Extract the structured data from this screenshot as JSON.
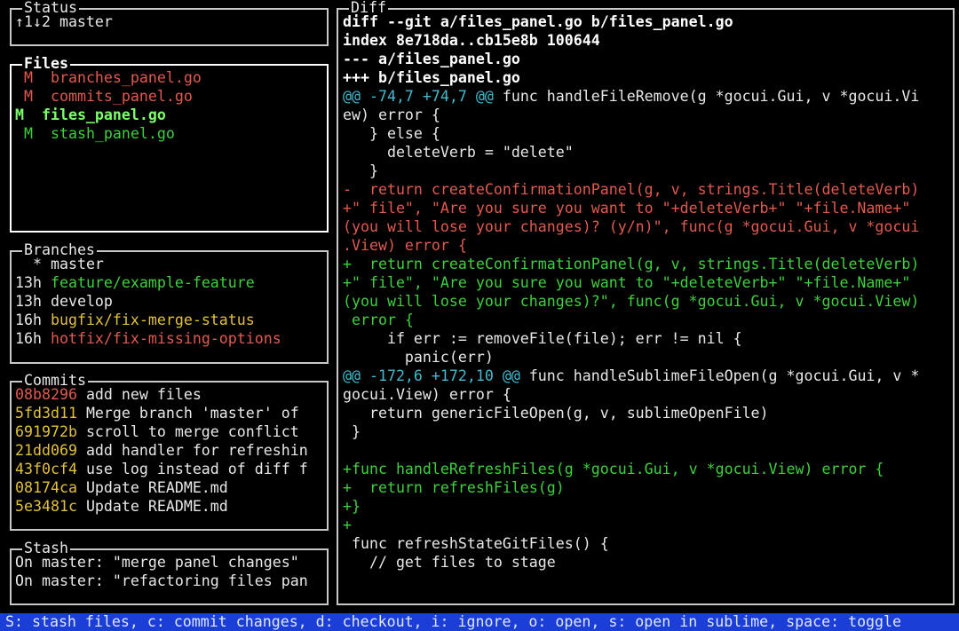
{
  "status": {
    "title": "Status",
    "text": "↑1↓2 master"
  },
  "files": {
    "title": "Files",
    "items": [
      {
        "status": "M",
        "name": "branches_panel.go",
        "color": "#e05a4f",
        "selected": false
      },
      {
        "status": "M",
        "name": "commits_panel.go",
        "color": "#e05a4f",
        "selected": false
      },
      {
        "status": "M",
        "name": "files_panel.go",
        "color": "#7cff6a",
        "selected": true
      },
      {
        "status": "M",
        "name": "stash_panel.go",
        "color": "#3fd03f",
        "selected": false
      }
    ]
  },
  "branches": {
    "title": "Branches",
    "items": [
      {
        "age": "  *",
        "name": "master",
        "color": "#e8e8e8"
      },
      {
        "age": "13h",
        "name": "feature/example-feature",
        "color": "#3fd03f"
      },
      {
        "age": "13h",
        "name": "develop",
        "color": "#e8e8e8"
      },
      {
        "age": "16h",
        "name": "bugfix/fix-merge-status",
        "color": "#e2c13a"
      },
      {
        "age": "16h",
        "name": "hotfix/fix-missing-options",
        "color": "#e05a4f"
      }
    ]
  },
  "commits": {
    "title": "Commits",
    "items": [
      {
        "sha": "08b8296",
        "message": "add new files",
        "sha_color": "#e05a4f"
      },
      {
        "sha": "5fd3d11",
        "message": "Merge branch 'master' of",
        "sha_color": "#e2c13a"
      },
      {
        "sha": "691972b",
        "message": "scroll to merge conflict",
        "sha_color": "#e2c13a"
      },
      {
        "sha": "21dd069",
        "message": "add handler for refreshin",
        "sha_color": "#e2c13a"
      },
      {
        "sha": "43f0cf4",
        "message": "use log instead of diff f",
        "sha_color": "#e2c13a"
      },
      {
        "sha": "08174ca",
        "message": "Update README.md",
        "sha_color": "#e2c13a"
      },
      {
        "sha": "5e3481c",
        "message": "Update README.md",
        "sha_color": "#e2c13a"
      }
    ]
  },
  "stash": {
    "title": "Stash",
    "items": [
      "On master: \"merge panel changes\"",
      "On master: \"refactoring files pan"
    ]
  },
  "diff": {
    "title": "Diff",
    "lines": [
      {
        "text": "diff --git a/files_panel.go b/files_panel.go",
        "style": "boldwhite"
      },
      {
        "text": "index 8e718da..cb15e8b 100644",
        "style": "boldwhite"
      },
      {
        "text": "--- a/files_panel.go",
        "style": "boldwhite"
      },
      {
        "text": "+++ b/files_panel.go",
        "style": "boldwhite"
      },
      {
        "text": "@@ -74,7 +74,7 @@",
        "rest": " func handleFileRemove(g *gocui.Gui, v *gocui.Vi",
        "style": "hunk"
      },
      {
        "text": "ew) error {",
        "style": "default"
      },
      {
        "text": "   } else {",
        "style": "default"
      },
      {
        "text": "     deleteVerb = \"delete\"",
        "style": "default"
      },
      {
        "text": "   }",
        "style": "default"
      },
      {
        "text": "-  return createConfirmationPanel(g, v, strings.Title(deleteVerb)",
        "style": "red"
      },
      {
        "text": "+\" file\", \"Are you sure you want to \"+deleteVerb+\" \"+file.Name+\"",
        "style": "red"
      },
      {
        "text": "(you will lose your changes)? (y/n)\", func(g *gocui.Gui, v *gocui",
        "style": "red"
      },
      {
        "text": ".View) error {",
        "style": "red"
      },
      {
        "text": "+  return createConfirmationPanel(g, v, strings.Title(deleteVerb)",
        "style": "green"
      },
      {
        "text": "+\" file\", \"Are you sure you want to \"+deleteVerb+\" \"+file.Name+\"",
        "style": "green"
      },
      {
        "text": "(you will lose your changes)?\", func(g *gocui.Gui, v *gocui.View)",
        "style": "green"
      },
      {
        "text": " error {",
        "style": "green"
      },
      {
        "text": "     if err := removeFile(file); err != nil {",
        "style": "default"
      },
      {
        "text": "       panic(err)",
        "style": "default"
      },
      {
        "text": "@@ -172,6 +172,10 @@",
        "rest": " func handleSublimeFileOpen(g *gocui.Gui, v *",
        "style": "hunk"
      },
      {
        "text": "gocui.View) error {",
        "style": "default"
      },
      {
        "text": "   return genericFileOpen(g, v, sublimeOpenFile)",
        "style": "default"
      },
      {
        "text": " }",
        "style": "default"
      },
      {
        "text": "",
        "style": "default"
      },
      {
        "text": "+func handleRefreshFiles(g *gocui.Gui, v *gocui.View) error {",
        "style": "green"
      },
      {
        "text": "+  return refreshFiles(g)",
        "style": "green"
      },
      {
        "text": "+}",
        "style": "green"
      },
      {
        "text": "+",
        "style": "green"
      },
      {
        "text": " func refreshStateGitFiles() {",
        "style": "default"
      },
      {
        "text": "   // get files to stage",
        "style": "default"
      }
    ]
  },
  "footer": {
    "text": "S: stash files, c: commit changes, d: checkout, i: ignore, o: open, s: open in sublime, space: toggle"
  }
}
